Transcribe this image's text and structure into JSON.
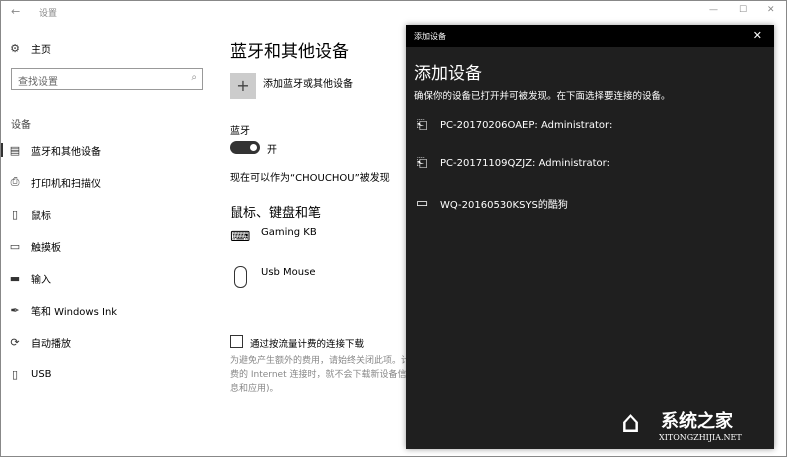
{
  "window": {
    "title": "设置",
    "back": "←",
    "min": "—",
    "max": "☐",
    "close": "✕"
  },
  "sidebar": {
    "home": "主页",
    "search_placeholder": "查找设置",
    "section": "设备",
    "items": [
      {
        "label": "蓝牙和其他设备",
        "icon": "bluetooth-devices-icon",
        "glyph": "▤"
      },
      {
        "label": "打印机和扫描仪",
        "icon": "printer-icon",
        "glyph": "⎙"
      },
      {
        "label": "鼠标",
        "icon": "mouse-icon",
        "glyph": "▯"
      },
      {
        "label": "触摸板",
        "icon": "touchpad-icon",
        "glyph": "▭"
      },
      {
        "label": "输入",
        "icon": "keyboard-icon",
        "glyph": "▬"
      },
      {
        "label": "笔和 Windows Ink",
        "icon": "pen-icon",
        "glyph": "✒"
      },
      {
        "label": "自动播放",
        "icon": "autoplay-icon",
        "glyph": "⟳"
      },
      {
        "label": "USB",
        "icon": "usb-icon",
        "glyph": "▯"
      }
    ]
  },
  "main": {
    "title": "蓝牙和其他设备",
    "add_label": "添加蓝牙或其他设备",
    "bt_label": "蓝牙",
    "bt_state": "开",
    "bt_on": true,
    "discoverable": "现在可以作为“CHOUCHOU”被发现",
    "mkp_heading": "鼠标、键盘和笔",
    "devices": [
      {
        "name": "Gaming KB",
        "icon": "keyboard-icon"
      },
      {
        "name": "Usb Mouse",
        "icon": "mouse-icon"
      }
    ],
    "metered_label": "通过按流量计费的连接下载",
    "metered_checked": false,
    "metered_desc": "为避免产生额外的费用，请始终关闭此项。计费的 Internet 连接时，就不会下载新设备信息和应用)。"
  },
  "dialog": {
    "bar_title": "添加设备",
    "title": "添加设备",
    "instructions": "确保你的设备已打开并可被发现。在下面选择要连接的设备。",
    "devices": [
      {
        "name": "PC-20170206OAEP: Administrator:",
        "icon": "media-device-icon"
      },
      {
        "name": "PC-20171109QZJZ: Administrator:",
        "icon": "media-device-icon"
      },
      {
        "name": "WQ-20160530KSYS的酷狗",
        "icon": "monitor-icon"
      }
    ]
  },
  "watermark": {
    "text": "系统之家",
    "url": "XITONGZHIJIA.NET"
  }
}
